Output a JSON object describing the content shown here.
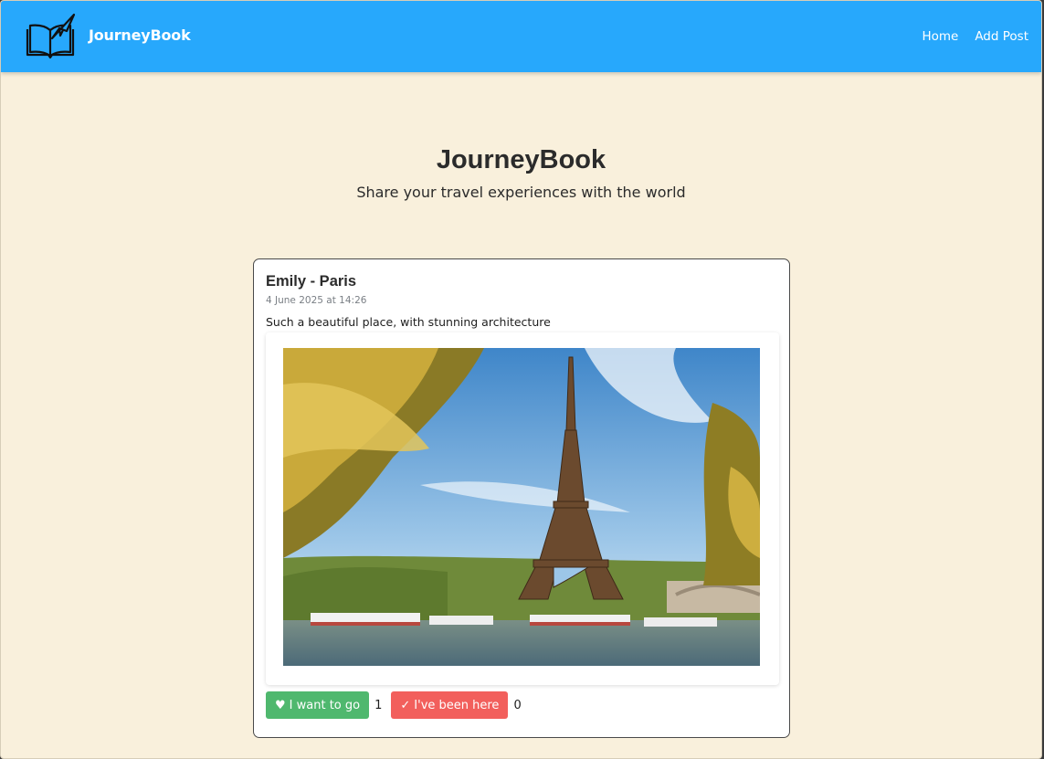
{
  "navbar": {
    "brand": "JourneyBook",
    "links": [
      "Home",
      "Add Post"
    ],
    "logo_icon": "open-book-paper-plane-icon",
    "background": "#27a8fc"
  },
  "hero": {
    "title": "JourneyBook",
    "subtitle": "Share your travel experiences with the world"
  },
  "post": {
    "title": "Emily - Paris",
    "date": "4 June 2025 at 14:26",
    "text": "Such a beautiful place, with stunning architecture",
    "image_icon": "eiffel-tower-photo",
    "want_to_go": {
      "icon": "♥",
      "label": "I want to go",
      "count": "1",
      "color": "#4fb86e"
    },
    "been_here": {
      "icon": "✓",
      "label": "I've been here",
      "count": "0",
      "color": "#f25f5c"
    }
  },
  "colors": {
    "page_background": "#f9f0dc",
    "card_border": "#4a4a4a"
  }
}
